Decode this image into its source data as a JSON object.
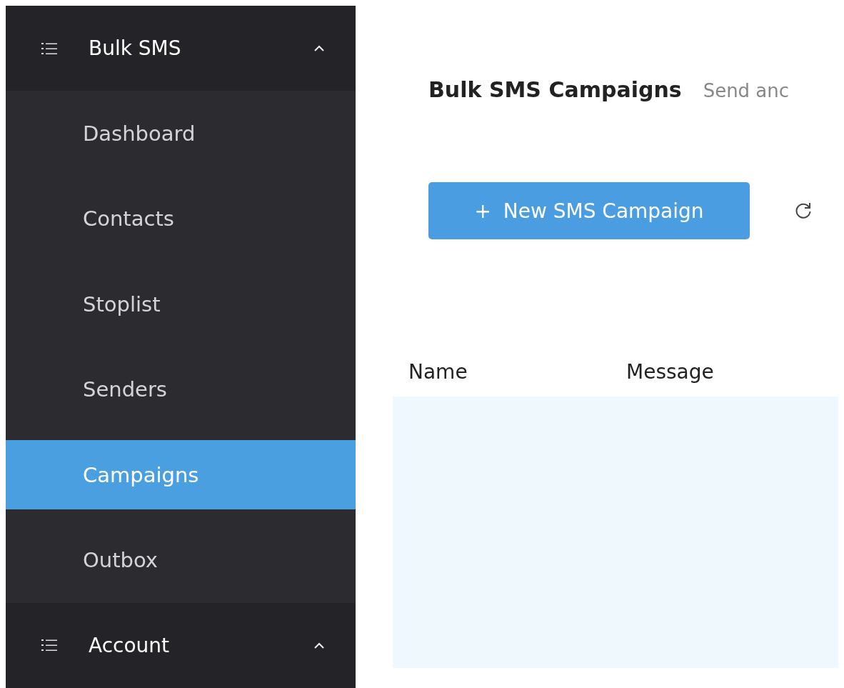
{
  "sidebar": {
    "groups": [
      {
        "label": "Bulk SMS",
        "expanded": true,
        "items": [
          {
            "label": "Dashboard",
            "selected": false
          },
          {
            "label": "Contacts",
            "selected": false
          },
          {
            "label": "Stoplist",
            "selected": false
          },
          {
            "label": "Senders",
            "selected": false
          },
          {
            "label": "Campaigns",
            "selected": true
          },
          {
            "label": "Outbox",
            "selected": false
          }
        ]
      },
      {
        "label": "Account",
        "expanded": true
      }
    ]
  },
  "page": {
    "title": "Bulk SMS Campaigns",
    "subtitle": "Send anc"
  },
  "toolbar": {
    "new_button": {
      "icon": "+",
      "label": "New SMS Campaign"
    }
  },
  "table": {
    "columns": [
      "Name",
      "Message"
    ]
  }
}
